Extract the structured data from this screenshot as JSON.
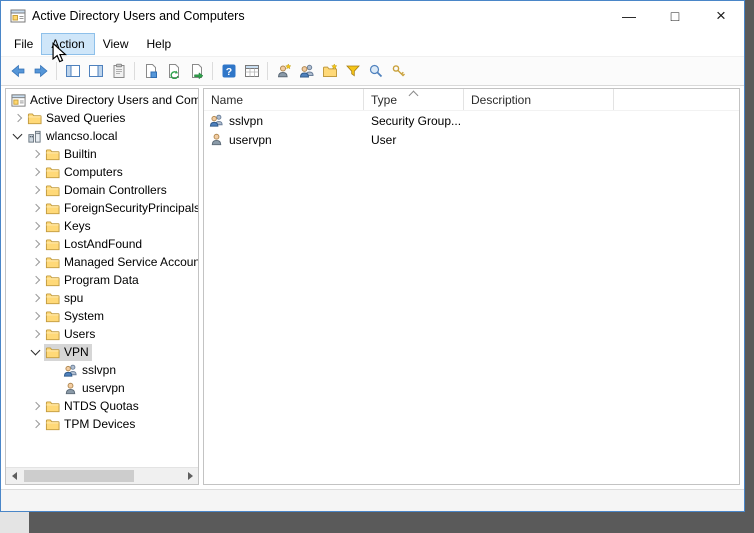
{
  "window": {
    "title": "Active Directory Users and Computers",
    "controls": {
      "minimize": "—",
      "maximize": "□",
      "close": "×"
    }
  },
  "menu": {
    "items": [
      {
        "label": "File",
        "state": "normal"
      },
      {
        "label": "Action",
        "state": "hover"
      },
      {
        "label": "View",
        "state": "normal"
      },
      {
        "label": "Help",
        "state": "normal"
      }
    ]
  },
  "toolbar": {
    "icons": [
      "back-icon",
      "forward-icon",
      "console-tree-toggle-icon",
      "action-pane-toggle-icon",
      "clipboard-icon",
      "properties-icon",
      "refresh-icon",
      "export-list-icon",
      "help-icon",
      "columns-icon",
      "create-user-icon",
      "create-group-icon",
      "create-ou-icon",
      "filter-icon",
      "find-icon",
      "keys-icon"
    ]
  },
  "tree": {
    "items": [
      {
        "label": "Active Directory Users and Computers",
        "icon": "console-root-icon",
        "expander": "none",
        "selected": false
      },
      {
        "label": "Saved Queries",
        "icon": "folder-icon",
        "expander": "collapsed",
        "selected": false
      },
      {
        "label": "wlancso.local",
        "icon": "domain-icon",
        "expander": "expanded",
        "selected": false
      },
      {
        "label": "Builtin",
        "icon": "folder-icon",
        "expander": "collapsed",
        "selected": false
      },
      {
        "label": "Computers",
        "icon": "folder-icon",
        "expander": "collapsed",
        "selected": false
      },
      {
        "label": "Domain Controllers",
        "icon": "folder-icon",
        "expander": "collapsed",
        "selected": false
      },
      {
        "label": "ForeignSecurityPrincipals",
        "icon": "folder-icon",
        "expander": "collapsed",
        "selected": false
      },
      {
        "label": "Keys",
        "icon": "folder-icon",
        "expander": "collapsed",
        "selected": false
      },
      {
        "label": "LostAndFound",
        "icon": "folder-icon",
        "expander": "collapsed",
        "selected": false
      },
      {
        "label": "Managed Service Accounts",
        "icon": "folder-icon",
        "expander": "collapsed",
        "selected": false
      },
      {
        "label": "Program Data",
        "icon": "folder-icon",
        "expander": "collapsed",
        "selected": false
      },
      {
        "label": "spu",
        "icon": "folder-icon",
        "expander": "collapsed",
        "selected": false
      },
      {
        "label": "System",
        "icon": "folder-icon",
        "expander": "collapsed",
        "selected": false
      },
      {
        "label": "Users",
        "icon": "folder-icon",
        "expander": "collapsed",
        "selected": false
      },
      {
        "label": "VPN",
        "icon": "folder-icon",
        "expander": "expanded",
        "selected": true
      },
      {
        "label": "sslvpn",
        "icon": "group-icon",
        "expander": "none",
        "selected": false
      },
      {
        "label": "uservpn",
        "icon": "user-icon",
        "expander": "none",
        "selected": false
      },
      {
        "label": "NTDS Quotas",
        "icon": "folder-icon",
        "expander": "collapsed",
        "selected": false
      },
      {
        "label": "TPM Devices",
        "icon": "folder-icon",
        "expander": "collapsed",
        "selected": false
      }
    ]
  },
  "list": {
    "columns": [
      {
        "label": "Name",
        "sorted": false
      },
      {
        "label": "Type",
        "sorted": true
      },
      {
        "label": "Description",
        "sorted": false
      }
    ],
    "rows": [
      {
        "icon": "group-icon",
        "name": "sslvpn",
        "type": "Security Group...",
        "description": ""
      },
      {
        "icon": "user-icon",
        "name": "uservpn",
        "type": "User",
        "description": ""
      }
    ]
  },
  "colors": {
    "accent": "#2f76c8",
    "menu_highlight": "#cfe6f9",
    "menu_highlight_border": "#8ec0ea",
    "selection_inactive": "#d6d6d6",
    "folder": "#ffd978"
  }
}
